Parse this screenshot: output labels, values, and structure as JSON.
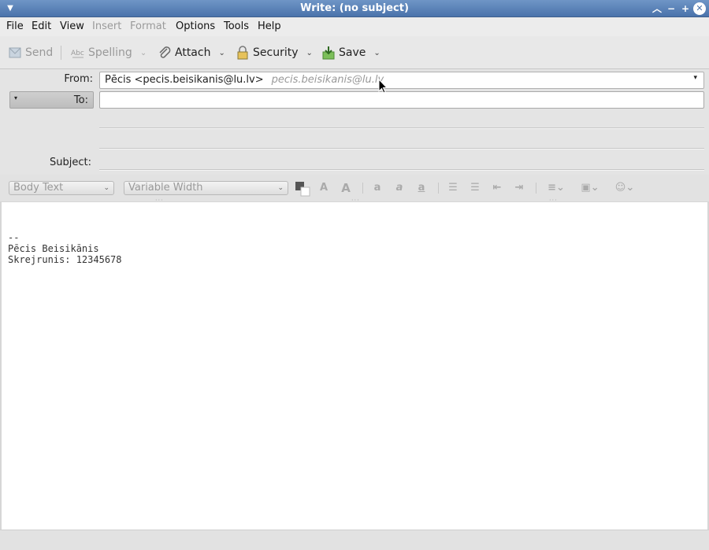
{
  "window": {
    "title": "Write: (no subject)"
  },
  "menu": {
    "items": [
      {
        "label": "File",
        "enabled": true
      },
      {
        "label": "Edit",
        "enabled": true
      },
      {
        "label": "View",
        "enabled": true
      },
      {
        "label": "Insert",
        "enabled": false
      },
      {
        "label": "Format",
        "enabled": false
      },
      {
        "label": "Options",
        "enabled": true
      },
      {
        "label": "Tools",
        "enabled": true
      },
      {
        "label": "Help",
        "enabled": true
      }
    ]
  },
  "toolbar": {
    "send_label": "Send",
    "spelling_label": "Spelling",
    "attach_label": "Attach",
    "security_label": "Security",
    "save_label": "Save"
  },
  "header": {
    "from_label": "From:",
    "from_value": "Pēcis <pecis.beisikanis@lu.lv>",
    "from_hint": "pecis.beisikanis@lu.lv",
    "to_label": "To:",
    "to_value": "",
    "subject_label": "Subject:",
    "subject_value": ""
  },
  "format_toolbar": {
    "paragraph_style": "Body Text",
    "font_family": "Variable Width"
  },
  "body": {
    "lines": [
      "--",
      "Pēcis Beisikānis",
      "Skrejrunis: 12345678"
    ]
  },
  "colors": {
    "titlebar": "#4a73ab",
    "chrome": "#e4e4e4",
    "editor_bg": "#ffffff"
  }
}
